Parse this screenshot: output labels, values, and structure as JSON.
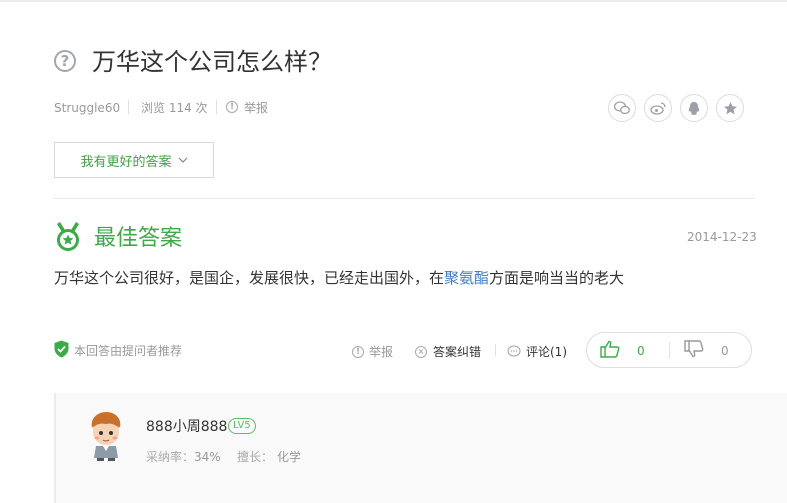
{
  "question": {
    "title": "万华这个公司怎么样？",
    "author": "Struggle60",
    "views": "浏览 114 次",
    "report": "举报"
  },
  "share_icons": [
    "wechat-icon",
    "weibo-icon",
    "qq-icon",
    "star-icon"
  ],
  "better_answer_button": "我有更好的答案",
  "best_answer": {
    "label": "最佳答案",
    "date": "2014-12-23",
    "text_before": "万华这个公司很好，是国企，发展很快，已经走出国外，在",
    "keyword": "聚氨酯",
    "text_after": "方面是响当当的老大",
    "recommend": "本回答由提问者推荐",
    "report": "举报",
    "correct": "答案纠错",
    "comment": "评论(1)",
    "likes": "0",
    "dislikes": "0"
  },
  "answerer": {
    "name": "888小周888",
    "level": "LV5",
    "adoption_label": "采纳率：",
    "adoption_value": "34%",
    "expertise_label": "擅长：",
    "expertise_value": "化学"
  },
  "colors": {
    "accent_green": "#3daa4a",
    "link_blue": "#3f7dc5",
    "muted_gray": "#999999"
  }
}
